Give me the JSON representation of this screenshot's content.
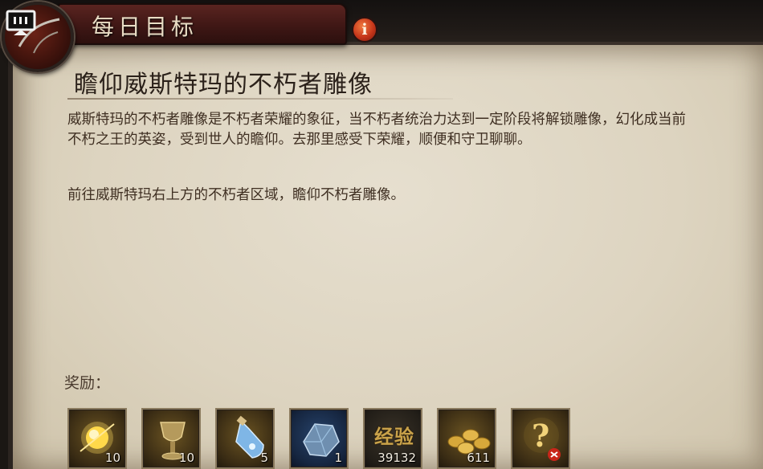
{
  "header": {
    "tab_title": "每日目标",
    "info_glyph": "i",
    "emblem_icon": "crest-icon",
    "screen_icon": "screen-share-icon"
  },
  "quest": {
    "title": "瞻仰威斯特玛的不朽者雕像",
    "description": "威斯特玛的不朽者雕像是不朽者荣耀的象征，当不朽者统治力达到一定阶段将解锁雕像，幻化成当前不朽之王的英姿，受到世人的瞻仰。去那里感受下荣耀，顺便和守卫聊聊。",
    "hint": "前往威斯特玛右上方的不朽者区域，瞻仰不朽者雕像。"
  },
  "rewards": {
    "label": "奖励：",
    "items": [
      {
        "icon": "glowing-orb-icon",
        "qty": "10",
        "frame": "gold"
      },
      {
        "icon": "chalice-icon",
        "qty": "10",
        "frame": "gold"
      },
      {
        "icon": "potion-bottle-icon",
        "qty": "5",
        "frame": "gold"
      },
      {
        "icon": "ore-crystal-icon",
        "qty": "1",
        "frame": "blue"
      },
      {
        "icon": "experience-icon",
        "text": "经验",
        "qty": "39132",
        "frame": "dark"
      },
      {
        "icon": "gold-coins-icon",
        "qty": "611",
        "frame": "gold"
      },
      {
        "icon": "mystery-reward-icon",
        "qty": "",
        "frame": "gold"
      }
    ]
  },
  "colors": {
    "parchment": "#e2dac8",
    "tab": "#4a1c18",
    "text": "#3f2f22",
    "accent": "#c6361a"
  }
}
